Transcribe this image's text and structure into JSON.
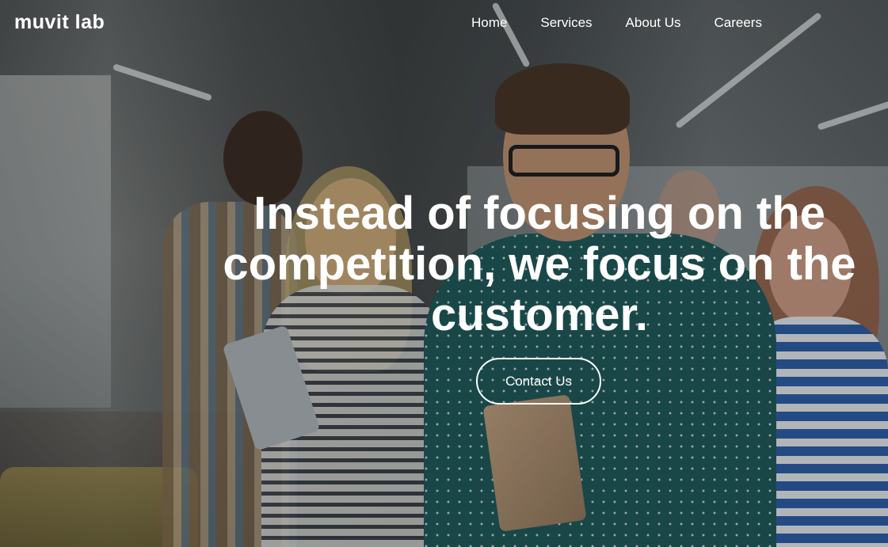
{
  "header": {
    "logo_text": "muvit lab",
    "nav": [
      {
        "label": "Home"
      },
      {
        "label": "Services"
      },
      {
        "label": "About Us"
      },
      {
        "label": "Careers"
      }
    ]
  },
  "hero": {
    "headline": "Instead of focusing on the competition, we focus on the customer.",
    "cta_label": "Contact Us",
    "background_image": "team-of-smiling-coworkers-photo"
  },
  "colors": {
    "text": "#ffffff",
    "overlay": "#0a1419"
  }
}
